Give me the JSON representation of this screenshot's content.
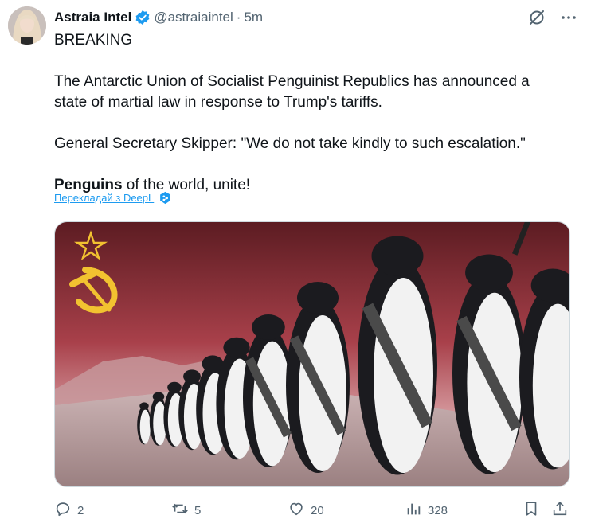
{
  "author": {
    "name": "Astraia Intel",
    "handle": "@astraiaintel",
    "separator": "·",
    "time": "5m"
  },
  "body": {
    "line1": "BREAKING",
    "line2": "The Antarctic Union of Socialist Penguinist Republics has announced a state of martial law in response to Trump's tariffs.",
    "line3": "General Secretary Skipper: \"We do not take kindly to such escalation.\"",
    "line4_bold": "Penguins",
    "line4_rest": " of the world, unite!"
  },
  "translate": {
    "label": "Перекладай з DeepL"
  },
  "actions": {
    "replies": "2",
    "reposts": "5",
    "likes": "20",
    "views": "328"
  },
  "colors": {
    "accent": "#1d9bf0",
    "muted": "#536471",
    "text": "#0f1419",
    "flag_red": "#a8323a",
    "flag_yellow": "#f2c230"
  },
  "icons": [
    "grok-icon",
    "more-icon",
    "verified-icon",
    "reply-icon",
    "repost-icon",
    "like-icon",
    "views-icon",
    "bookmark-icon",
    "share-icon",
    "deepl-icon"
  ]
}
